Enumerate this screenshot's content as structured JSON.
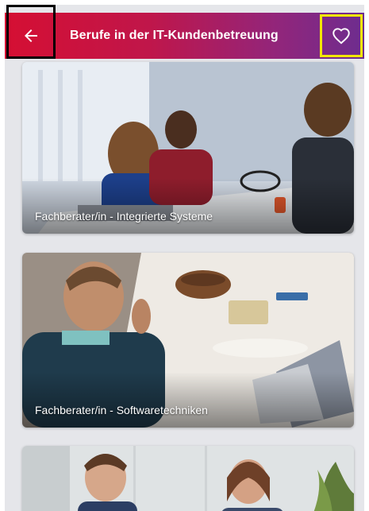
{
  "appbar": {
    "title": "Berufe in der IT-Kundenbetreuung",
    "back_icon": "arrow-left-icon",
    "favorite_icon": "heart-outline-icon",
    "gradient": [
      "#d50f33",
      "#6d2d8f"
    ]
  },
  "careers": [
    {
      "label": "Fachberater/in - Integrierte Systeme"
    },
    {
      "label": "Fachberater/in - Softwaretechniken"
    },
    {
      "label": ""
    }
  ]
}
